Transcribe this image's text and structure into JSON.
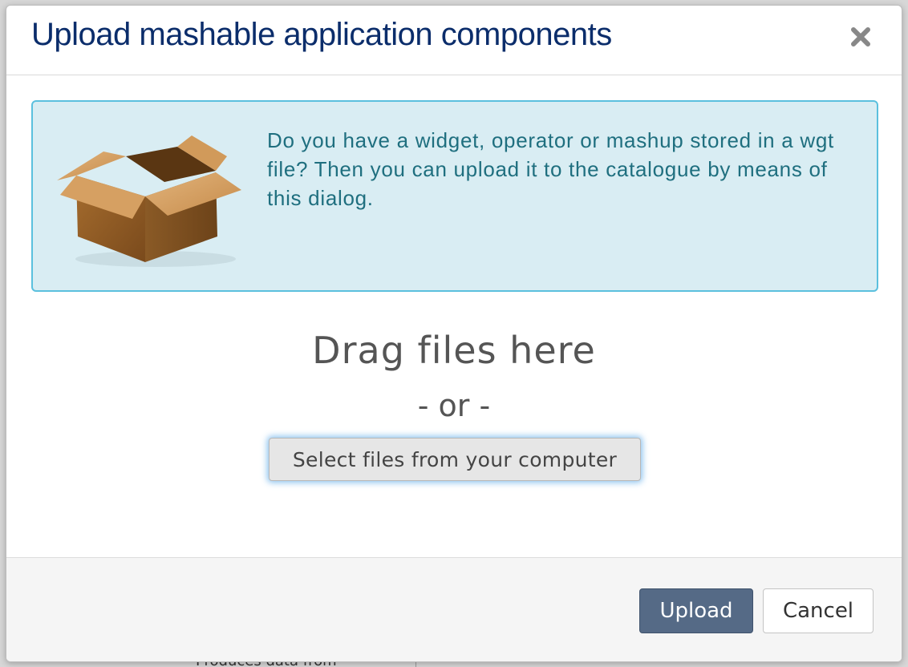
{
  "background": {
    "partial_text": "Produces data from"
  },
  "dialog": {
    "title": "Upload mashable application components",
    "close_icon": "close-icon",
    "info": {
      "icon": "open-box-icon",
      "text": "Do you have a widget, operator or mashup stored in a wgt file? Then you can upload it to the catalogue by means of this dialog."
    },
    "dropzone": {
      "heading": "Drag files here",
      "separator": "- or -",
      "select_button": "Select files from your computer"
    },
    "footer": {
      "upload_label": "Upload",
      "cancel_label": "Cancel"
    }
  },
  "colors": {
    "title": "#0b2d6b",
    "info_bg": "#d9edf3",
    "info_border": "#5bc0de",
    "info_text": "#1f6f7f",
    "primary_button": "#556a86",
    "footer_bg": "#f5f5f5"
  }
}
